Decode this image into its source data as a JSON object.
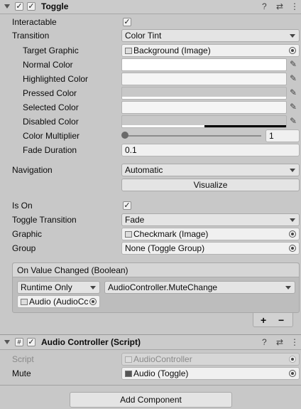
{
  "toggle_header": {
    "title": "Toggle",
    "enabled": true,
    "icon": "toggle-icon"
  },
  "props": {
    "interactable": {
      "label": "Interactable",
      "checked": true
    },
    "transition": {
      "label": "Transition",
      "value": "Color Tint"
    },
    "target_graphic": {
      "label": "Target Graphic",
      "value": "Background (Image)"
    },
    "normal_color": {
      "label": "Normal Color",
      "color": "#ffffff"
    },
    "highlighted_color": {
      "label": "Highlighted Color",
      "color": "#f5f5f5"
    },
    "pressed_color": {
      "label": "Pressed Color",
      "color": "#c8c8c8",
      "alpha": 1.0
    },
    "selected_color": {
      "label": "Selected Color",
      "color": "#f5f5f5"
    },
    "disabled_color": {
      "label": "Disabled Color",
      "color": "#c8c8c8",
      "alpha": 0.5
    },
    "color_multiplier": {
      "label": "Color Multiplier",
      "value": "1",
      "slider_fraction": 0.0
    },
    "fade_duration": {
      "label": "Fade Duration",
      "value": "0.1"
    },
    "navigation": {
      "label": "Navigation",
      "value": "Automatic"
    },
    "visualize": {
      "label": "Visualize"
    },
    "is_on": {
      "label": "Is On",
      "checked": true
    },
    "toggle_transition": {
      "label": "Toggle Transition",
      "value": "Fade"
    },
    "graphic": {
      "label": "Graphic",
      "value": "Checkmark (Image)"
    },
    "group": {
      "label": "Group",
      "value": "None (Toggle Group)"
    }
  },
  "event": {
    "title": "On Value Changed (Boolean)",
    "runtime": "Runtime Only",
    "function": "AudioController.MuteChange",
    "object": "Audio (AudioCc",
    "add": "+",
    "remove": "−"
  },
  "script_header": {
    "title": "Audio Controller (Script)",
    "enabled": true,
    "icon": "script-icon"
  },
  "script_props": {
    "script": {
      "label": "Script",
      "value": "AudioController"
    },
    "mute": {
      "label": "Mute",
      "value": "Audio (Toggle)"
    }
  },
  "add_component": "Add Component",
  "icons": {
    "help": "?",
    "settings": "⇄",
    "menu": "⋮",
    "check": "✓",
    "picker": "✎"
  }
}
